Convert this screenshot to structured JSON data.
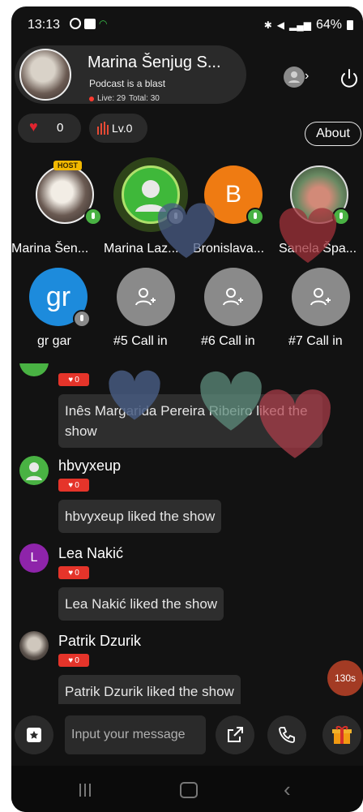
{
  "status_bar": {
    "time": "13:13",
    "battery": "64%"
  },
  "host": {
    "name": "Marina Šenjug S...",
    "subtitle": "Podcast is a blast",
    "live": "Live: 29",
    "total": "Total: 30"
  },
  "stats": {
    "likes": "0",
    "level": "Lv.0",
    "about_label": "About"
  },
  "seats_row1": [
    {
      "label": "Marina Šen...",
      "tag": "HOST",
      "kind": "photo-host"
    },
    {
      "label": "Marina Laz...",
      "kind": "default-green"
    },
    {
      "label": "Bronislava...",
      "initial": "B",
      "kind": "letter-orange"
    },
    {
      "label": "Sanela Špa...",
      "kind": "photo-green"
    }
  ],
  "seats_row2": [
    {
      "label": "gr gar",
      "initial": "gr"
    },
    {
      "label": "#5 Call in"
    },
    {
      "label": "#6 Call in"
    },
    {
      "label": "#7 Call in"
    }
  ],
  "chat": {
    "messages": [
      {
        "name": "",
        "badge": "0",
        "text": "Inês Margarida Pereira Ribeiro liked the show"
      },
      {
        "name": "hbvyxeup",
        "badge": "0",
        "text": "hbvyxeup liked the show"
      },
      {
        "name": "Lea Nakić",
        "badge": "0",
        "text": "Lea Nakić liked the show",
        "initial": "L"
      },
      {
        "name": "Patrik Dzurik",
        "badge": "0",
        "text": "Patrik Dzurik liked the show"
      }
    ],
    "timer": "130s"
  },
  "composer": {
    "placeholder": "Input your message"
  },
  "colors": {
    "accent_red": "#e5342a",
    "online_green": "#49b243",
    "background": "#121212"
  }
}
